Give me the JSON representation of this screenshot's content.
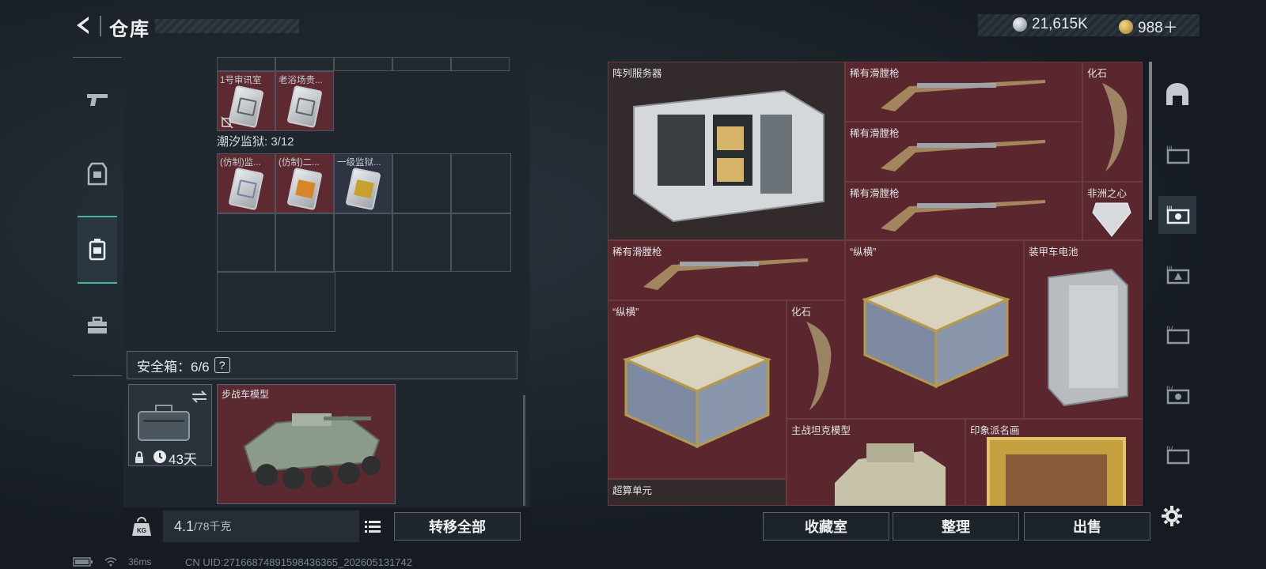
{
  "header": {
    "title": "仓库"
  },
  "currency": {
    "coins": "21,615K",
    "bonds": "988＋",
    "coin_color": "#c9d1d8",
    "bond_color": "#d7b04a"
  },
  "leftnav": {
    "items": [
      "weapons-icon",
      "gear-icon",
      "container-icon",
      "toolbox-icon"
    ],
    "active_index": 2
  },
  "stash": {
    "top_items": [
      "1号审讯室",
      "老浴场贵..."
    ],
    "prison_label": "潮汐监狱: 3/12",
    "prison_items": [
      "(仿制)监...",
      "(仿制)二...",
      "一级监狱..."
    ],
    "safe_label": "安全箱：6/6",
    "safe_help": "?",
    "safe_days": "43天",
    "ifv_name": "步战车模型",
    "weight_value": "4.1",
    "weight_max": "/78千克",
    "transfer_label": "转移全部"
  },
  "collection": {
    "items": [
      {
        "name": "阵列服务器"
      },
      {
        "name": "稀有滑膛枪"
      },
      {
        "name": "稀有滑膛枪"
      },
      {
        "name": "稀有滑膛枪"
      },
      {
        "name": "化石"
      },
      {
        "name": "非洲之心"
      },
      {
        "name": "稀有滑膛枪"
      },
      {
        "name": "“纵横”"
      },
      {
        "name": "装甲车电池"
      },
      {
        "name": "“纵横”"
      },
      {
        "name": "化石"
      },
      {
        "name": "主战坦克模型"
      },
      {
        "name": "印象派名画"
      },
      {
        "name": "超算单元"
      }
    ]
  },
  "actions": {
    "collection_room": "收藏室",
    "sort": "整理",
    "sell": "出售"
  },
  "status": {
    "ping": "36ms",
    "uid": "CN UID:27166874891598436365_202605131742"
  }
}
